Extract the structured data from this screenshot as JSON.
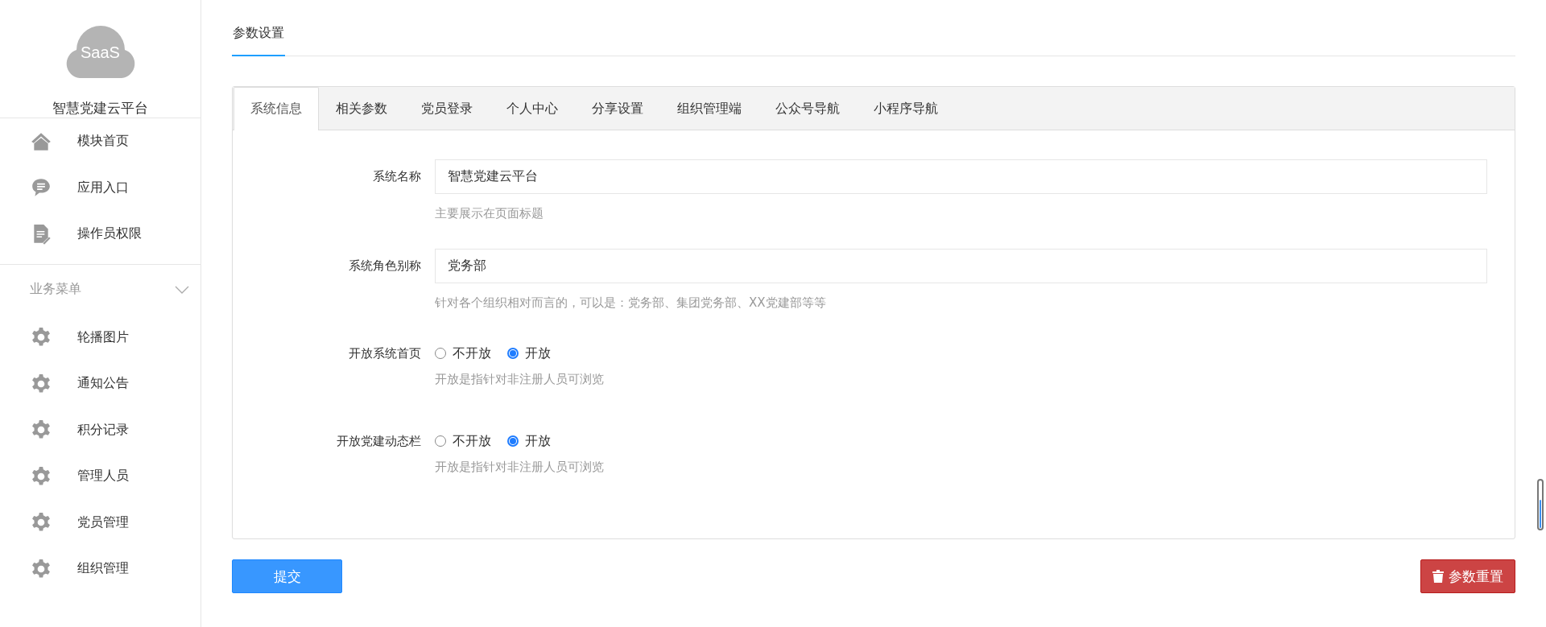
{
  "sidebar": {
    "logo_text": "SaaS",
    "title": "智慧党建云平台",
    "top_items": [
      {
        "label": "模块首页",
        "kind": "home"
      },
      {
        "label": "应用入口",
        "kind": "chat"
      },
      {
        "label": "操作员权限",
        "kind": "doc"
      }
    ],
    "section": {
      "label": "业务菜单",
      "expanded": true,
      "items": [
        {
          "label": "轮播图片",
          "kind": "gear"
        },
        {
          "label": "通知公告",
          "kind": "gear"
        },
        {
          "label": "积分记录",
          "kind": "gear"
        },
        {
          "label": "管理人员",
          "kind": "gear"
        },
        {
          "label": "党员管理",
          "kind": "gear"
        },
        {
          "label": "组织管理",
          "kind": "gear"
        }
      ]
    }
  },
  "page_tabs": [
    {
      "label": "参数设置",
      "selected": true
    }
  ],
  "tabs": [
    {
      "label": "系统信息",
      "selected": true
    },
    {
      "label": "相关参数",
      "selected": false
    },
    {
      "label": "党员登录",
      "selected": false
    },
    {
      "label": "个人中心",
      "selected": false
    },
    {
      "label": "分享设置",
      "selected": false
    },
    {
      "label": "组织管理端",
      "selected": false
    },
    {
      "label": "公众号导航",
      "selected": false
    },
    {
      "label": "小程序导航",
      "selected": false
    }
  ],
  "form": [
    {
      "kind": "text",
      "label": "系统名称",
      "value": "智慧党建云平台",
      "help": "主要展示在页面标题"
    },
    {
      "kind": "text",
      "label": "系统角色别称",
      "value": "党务部",
      "help": "针对各个组织相对而言的，可以是：党务部、集团党务部、XX党建部等等"
    },
    {
      "kind": "radio",
      "label": "开放系统首页",
      "options": [
        {
          "label": "不开放",
          "selected": false
        },
        {
          "label": "开放",
          "selected": true
        }
      ],
      "help": "开放是指针对非注册人员可浏览"
    },
    {
      "kind": "radio",
      "label": "开放党建动态栏",
      "options": [
        {
          "label": "不开放",
          "selected": false
        },
        {
          "label": "开放",
          "selected": true
        }
      ],
      "help": "开放是指针对非注册人员可浏览"
    }
  ],
  "submit_button": "提交",
  "reset_button": "参数重置"
}
